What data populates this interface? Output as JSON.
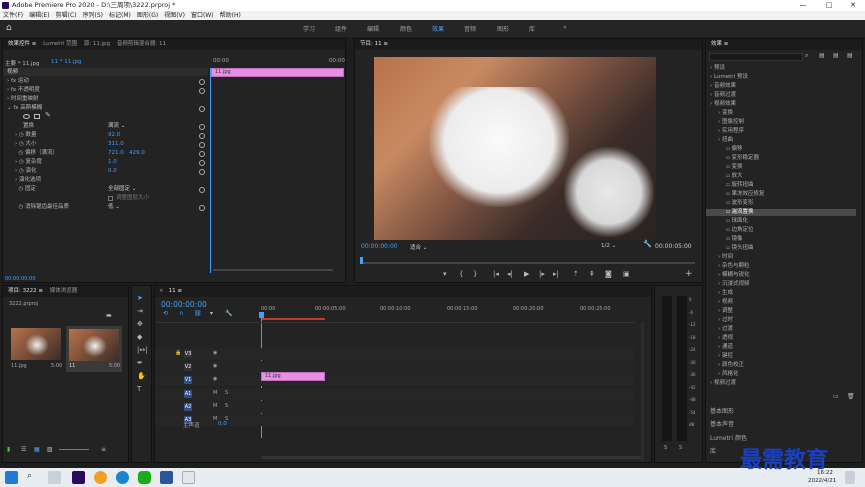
{
  "window": {
    "title": "Adobe Premiere Pro 2020 - D:\\三周项\\3222.prproj *",
    "minimize": "—",
    "maximize": "□",
    "close": "✕"
  },
  "menu": [
    "文件(F)",
    "编辑(E)",
    "剪辑(C)",
    "序列(S)",
    "标记(M)",
    "图形(G)",
    "视图(V)",
    "窗口(W)",
    "帮助(H)"
  ],
  "workspaces": [
    "学习",
    "组件",
    "编辑",
    "颜色",
    "效果",
    "音频",
    "图形",
    "库"
  ],
  "workspace_active": "效果",
  "effect_controls": {
    "tabs": [
      "效果控件 ≡",
      "Lumetri 范围",
      "源: 11.jpg",
      "音频剪辑混合器: 11"
    ],
    "source": "主要 * 11.jpg",
    "clip": "11 * 11.jpg",
    "clip_label": "11.jpg",
    "time_start": "00:00",
    "time_end": "00:00",
    "section": "视频",
    "rows": [
      {
        "name": "fx 运动"
      },
      {
        "name": "fx 不透明度"
      },
      {
        "name": "时间重映射"
      },
      {
        "name": "fx 高斯模糊"
      },
      {
        "name": "置换",
        "value": "满流"
      },
      {
        "name": "数量",
        "value": "92.0"
      },
      {
        "name": "大小",
        "value": "311.0"
      },
      {
        "name": "偏移（满流）",
        "value": "721.0",
        "value2": "429.0"
      },
      {
        "name": "复杂度",
        "value": "1.0"
      },
      {
        "name": "演化",
        "value": "0.0"
      },
      {
        "name": "演化选项"
      },
      {
        "name": "固定",
        "value": "全部固定"
      },
      {
        "name": "",
        "value": "调整图层大小"
      },
      {
        "name": "消除锯齿最佳品质",
        "value": "低"
      }
    ],
    "bottom_time": "00:00:00:00"
  },
  "program": {
    "title": "节目: 11 ≡",
    "timecode": "00:00:00:00",
    "fit": "适合",
    "quality": "1/2",
    "duration": "00:00:05:00"
  },
  "effects": {
    "title": "效果 ≡",
    "items": [
      {
        "label": "预设",
        "indent": 0
      },
      {
        "label": "Lumetri 预设",
        "indent": 0
      },
      {
        "label": "音频效果",
        "indent": 0
      },
      {
        "label": "音频过渡",
        "indent": 0
      },
      {
        "label": "视频效果",
        "indent": 0
      },
      {
        "label": "变换",
        "indent": 1
      },
      {
        "label": "图像控制",
        "indent": 1
      },
      {
        "label": "实用程序",
        "indent": 1
      },
      {
        "label": "扭曲",
        "indent": 1
      },
      {
        "label": "偏移",
        "indent": 2
      },
      {
        "label": "变形稳定器",
        "indent": 2
      },
      {
        "label": "变换",
        "indent": 2
      },
      {
        "label": "放大",
        "indent": 2
      },
      {
        "label": "旋转扭曲",
        "indent": 2
      },
      {
        "label": "果冻效应修复",
        "indent": 2
      },
      {
        "label": "波形变形",
        "indent": 2
      },
      {
        "label": "湍流置换",
        "indent": 2,
        "selected": true
      },
      {
        "label": "球面化",
        "indent": 2
      },
      {
        "label": "边角定位",
        "indent": 2
      },
      {
        "label": "镜像",
        "indent": 2
      },
      {
        "label": "镜头扭曲",
        "indent": 2
      },
      {
        "label": "时间",
        "indent": 1
      },
      {
        "label": "杂色与颗粒",
        "indent": 1
      },
      {
        "label": "模糊与锐化",
        "indent": 1
      },
      {
        "label": "沉浸式视频",
        "indent": 1
      },
      {
        "label": "生成",
        "indent": 1
      },
      {
        "label": "视频",
        "indent": 1
      },
      {
        "label": "调整",
        "indent": 1
      },
      {
        "label": "过时",
        "indent": 1
      },
      {
        "label": "过渡",
        "indent": 1
      },
      {
        "label": "透视",
        "indent": 1
      },
      {
        "label": "通道",
        "indent": 1
      },
      {
        "label": "键控",
        "indent": 1
      },
      {
        "label": "颜色校正",
        "indent": 1
      },
      {
        "label": "风格化",
        "indent": 1
      },
      {
        "label": "视频过渡",
        "indent": 0
      }
    ],
    "bottom": [
      "基本图形",
      "基本声音",
      "Lumetri 颜色",
      "库"
    ]
  },
  "project": {
    "tabs": [
      "项目: 3222 ≡",
      "媒体浏览器"
    ],
    "file": "3222.prproj",
    "items": [
      {
        "name": "11.jpg",
        "dur": "5:00"
      },
      {
        "name": "11",
        "dur": "5:00"
      }
    ]
  },
  "timeline": {
    "tab": "11 ≡",
    "timecode": "00:00:00:00",
    "ruler": [
      "00:00",
      "00:00:05:00",
      "00:00:10:00",
      "00:00:15:00",
      "00:00:20:00",
      "00:00:25:00"
    ],
    "video_tracks": [
      "V3",
      "V2",
      "V1"
    ],
    "audio_tracks": [
      "A1",
      "A2",
      "A3"
    ],
    "master": "主声道",
    "master_val": "0.0",
    "clip": "11.jpg"
  },
  "meters": {
    "labels": [
      "0",
      "-6",
      "-12",
      "-18",
      "-24",
      "-30",
      "-36",
      "-42",
      "-48",
      "-54",
      "dB"
    ],
    "bottom": [
      "S",
      "S"
    ]
  },
  "taskbar": {
    "time": "16:22",
    "date": "2022/4/21"
  },
  "watermark": "最需教育",
  "colors": {
    "accent": "#3fa0ff",
    "clip": "#e68fe3",
    "selected": "#4a4a4a"
  }
}
